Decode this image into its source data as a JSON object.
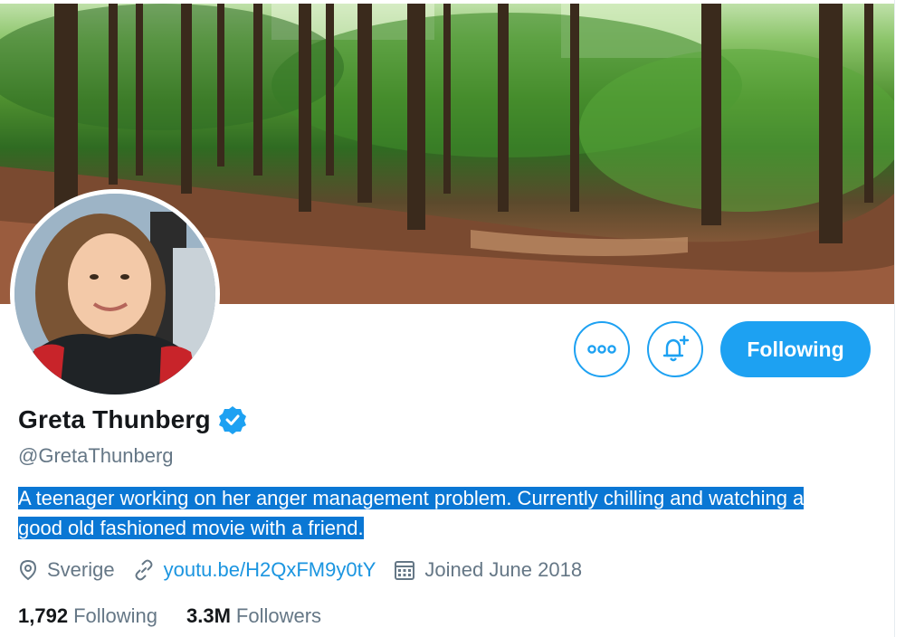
{
  "profile": {
    "name": "Greta Thunberg",
    "handle": "@GretaThunberg",
    "bio": "A teenager working on her anger management problem. Currently chilling and watching a good old fashioned movie with a friend.",
    "location": "Sverige",
    "link": "youtu.be/H2QxFM9y0tY",
    "joined": "Joined June 2018",
    "following_count": "1,792",
    "following_label": "Following",
    "followers_count": "3.3M",
    "followers_label": "Followers"
  },
  "actions": {
    "follow_button_label": "Following",
    "more_icon": "more-horizontal-icon",
    "notify_icon": "bell-plus-icon"
  },
  "colors": {
    "accent": "#1da1f2",
    "selection": "#0a77d4",
    "muted": "#657786",
    "link": "#1b95e0"
  }
}
